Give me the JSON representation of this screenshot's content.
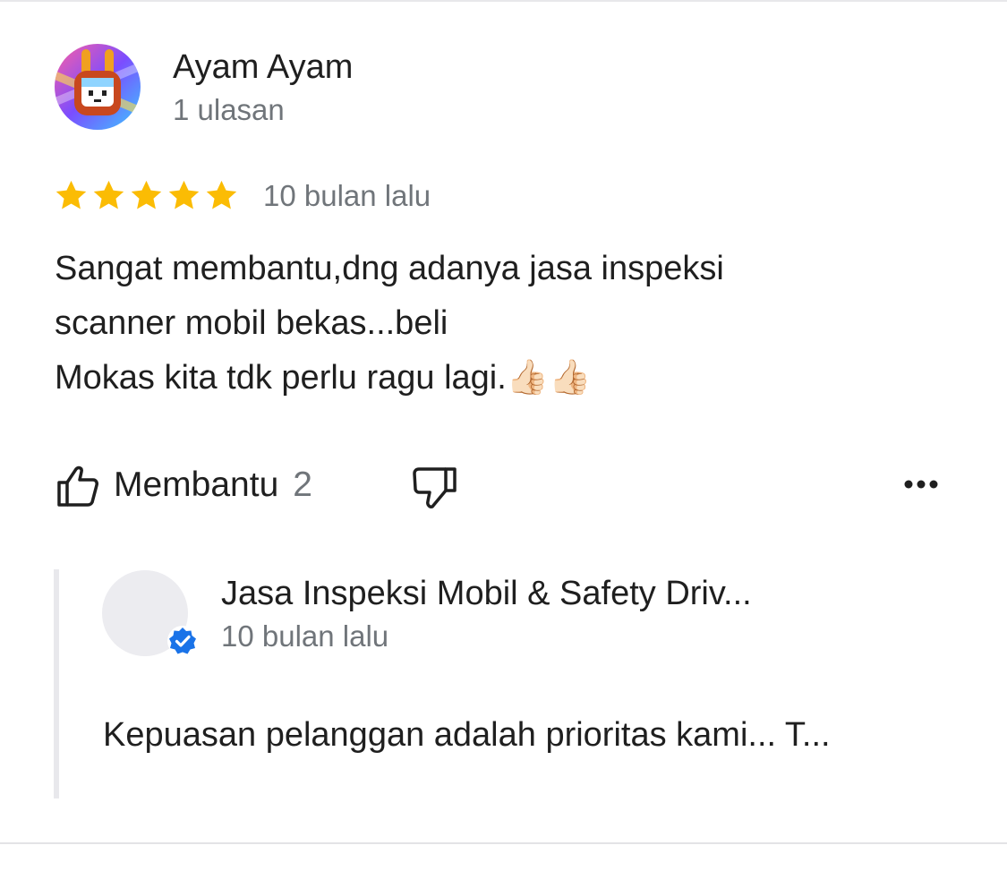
{
  "review": {
    "reviewer_name": "Ayam Ayam",
    "reviewer_reviews": "1 ulasan",
    "rating": 5,
    "rating_max": 5,
    "time": "10 bulan lalu",
    "text": "Sangat membantu,dng adanya jasa inspeksi\nscanner mobil bekas...beli\nMokas kita tdk perlu ragu lagi.👍🏻👍🏻"
  },
  "actions": {
    "helpful_label": "Membantu",
    "helpful_count": "2",
    "thumb_up_icon": "thumb-up-icon",
    "thumb_down_icon": "thumb-down-icon",
    "more_icon": "more-horizontal-icon"
  },
  "owner_reply": {
    "name": "Jasa Inspeksi Mobil & Safety Driv...",
    "time": "10 bulan lalu",
    "text": "Kepuasan pelanggan adalah prioritas kami... T...",
    "verified_icon": "verified-badge-icon"
  },
  "colors": {
    "star": "#fbbc04",
    "secondary_text": "#70757a",
    "primary_text": "#1f1f1f",
    "verified": "#1a73e8"
  }
}
